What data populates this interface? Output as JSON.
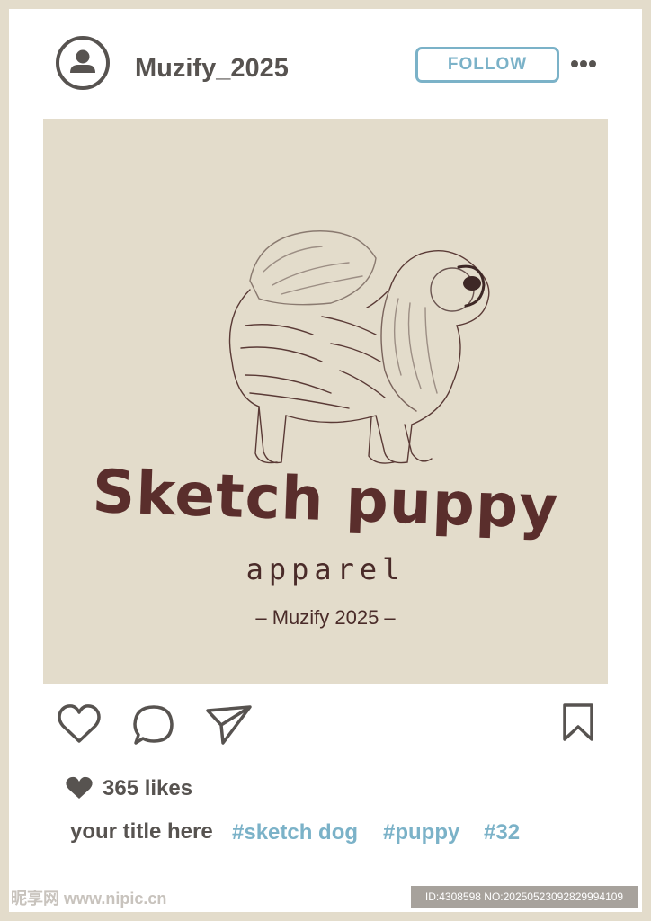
{
  "header": {
    "username": "Muzify_2025",
    "follow_label": "FOLLOW",
    "avatar_icon": "user-avatar-icon",
    "more_icon": "more-horizontal-icon"
  },
  "post": {
    "brand_title": "Sketch puppy",
    "brand_subtitle": "apparel",
    "brand_credit": "– Muzify 2025 –",
    "illustration": "sketch-chow-chow-dog"
  },
  "actions": {
    "like_icon": "heart-icon",
    "comment_icon": "comment-icon",
    "share_icon": "send-icon",
    "save_icon": "bookmark-icon"
  },
  "likes": {
    "text": "365 likes"
  },
  "caption": {
    "title": "your title here",
    "hashtags": [
      "#sketch dog",
      "#puppy",
      "#32"
    ]
  },
  "footer": {
    "watermark": "昵享网 www.nipic.cn",
    "id_text": "ID:4308598 NO:20250523092829994109"
  },
  "colors": {
    "background": "#e3dccb",
    "text": "#575350",
    "accent": "#7bb2c8",
    "brand": "#5a2e2c"
  }
}
